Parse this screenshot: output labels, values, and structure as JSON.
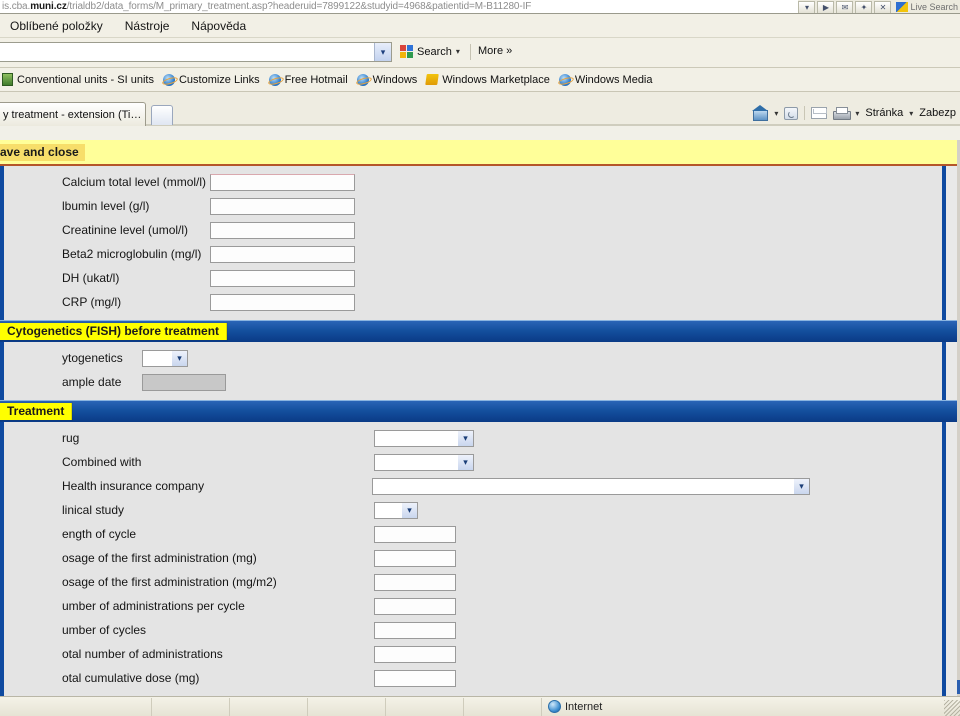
{
  "browser": {
    "url_prefix": "is.cba.",
    "url_domain": "muni.cz",
    "url_path": "/trialdb2/data_forms/M_primary_treatment.asp?headeruid=7899122&studyid=4968&patientid=M-B11280-IF",
    "address_dropdown_icon": "chevron-down-icon",
    "chrome_buttons": [
      {
        "name": "go-button",
        "glyph": "▶"
      },
      {
        "name": "mail-button",
        "glyph": "✉"
      },
      {
        "name": "messenger-button",
        "glyph": "✦"
      },
      {
        "name": "stop-button",
        "glyph": "✕"
      }
    ],
    "live_search_label": "Live Search",
    "menu": [
      {
        "label": "Oblíbené položky"
      },
      {
        "label": "Nástroje"
      },
      {
        "label": "Nápověda"
      }
    ],
    "toolbar": {
      "search_value": "",
      "search_placeholder": "",
      "search_label": "Search",
      "more_label": "More »",
      "google_icon": "google-icon",
      "dropdown_icon": "chevron-down-icon"
    },
    "links": [
      {
        "label": "Conventional units - SI units",
        "icon": "conversion-icon"
      },
      {
        "label": "Customize Links",
        "icon": "ie-icon"
      },
      {
        "label": "Free Hotmail",
        "icon": "ie-icon"
      },
      {
        "label": "Windows",
        "icon": "ie-icon"
      },
      {
        "label": "Windows Marketplace",
        "icon": "windows-icon"
      },
      {
        "label": "Windows Media",
        "icon": "ie-icon"
      }
    ],
    "tab": {
      "title": "y treatment - extension (Ti…",
      "new_tab_name": "new-tab-button"
    },
    "command_bar": {
      "home_icon": "home-icon",
      "feeds_icon": "rss-icon",
      "mail_icon": "mail-icon",
      "print_icon": "printer-icon",
      "page_label": "Stránka",
      "security_label": "Zabezp"
    }
  },
  "form": {
    "save_button_label": "ave and close",
    "lab_section": {
      "fields": [
        {
          "label": "Calcium total level (mmol/l)",
          "value": "",
          "type": "text",
          "first": true
        },
        {
          "label": "lbumin level (g/l)",
          "value": "",
          "type": "text"
        },
        {
          "label": "Creatinine level (umol/l)",
          "value": "",
          "type": "text"
        },
        {
          "label": "Beta2 microglobulin (mg/l)",
          "value": "",
          "type": "text"
        },
        {
          "label": "DH (ukat/l)",
          "value": "",
          "type": "text"
        },
        {
          "label": "CRP (mg/l)",
          "value": "",
          "type": "text"
        }
      ]
    },
    "cytogenetics_section": {
      "title": "Cytogenetics (FISH) before treatment",
      "fields": [
        {
          "label": "ytogenetics",
          "value": "",
          "type": "select"
        },
        {
          "label": "ample date",
          "value": "",
          "type": "disabled"
        }
      ]
    },
    "treatment_section": {
      "title": "Treatment",
      "fields": [
        {
          "label": "rug",
          "value": "",
          "type": "select-wide"
        },
        {
          "label": "Combined with",
          "value": "",
          "type": "select-wide"
        },
        {
          "label": "Health insurance company",
          "value": "",
          "type": "select-xwide"
        },
        {
          "label": "linical study",
          "value": "",
          "type": "select-narrow"
        },
        {
          "label": "ength of cycle",
          "value": "",
          "type": "text"
        },
        {
          "label": "osage of the first administration (mg)",
          "value": "",
          "type": "text"
        },
        {
          "label": "osage of the first administration (mg/m2)",
          "value": "",
          "type": "text"
        },
        {
          "label": "umber of administrations per cycle",
          "value": "",
          "type": "text"
        },
        {
          "label": "umber of cycles",
          "value": "",
          "type": "text"
        },
        {
          "label": "otal number of administrations",
          "value": "",
          "type": "text"
        },
        {
          "label": "otal cumulative dose (mg)",
          "value": "",
          "type": "text"
        }
      ]
    }
  },
  "statusbar": {
    "zone_label": "Internet",
    "zone_icon": "globe-icon"
  },
  "colors": {
    "save_bar": "#ffff99",
    "save_bar_border": "#b4562a",
    "section_header_blue": "#14509e",
    "section_title_yellow": "#ffff00",
    "panel_bg": "#e4e4e4",
    "page_bg": "#e9e9e9"
  }
}
